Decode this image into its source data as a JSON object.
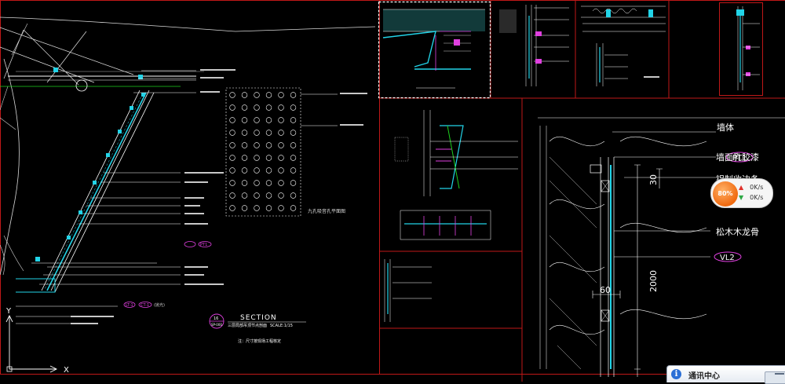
{
  "section_title": {
    "heading": "SECTION",
    "badge_top": "16",
    "badge_bottom": "SP-000",
    "name": "三层局部吊顶节点剖面",
    "scale": "SCALE:1/15",
    "note": "注：尺寸按现场工程核定"
  },
  "ucs": {
    "y_label": "Y",
    "x_label": "X"
  },
  "dims": {
    "d30": "30",
    "d2000": "2000",
    "d60": "60"
  },
  "detail_labels": {
    "wall": "墙体",
    "paint": "墙面乳胶漆",
    "paint_tag": "PT1",
    "trim": "铝制收边条",
    "wood": "松木木龙骨",
    "vl_tag": "VL2"
  },
  "panel_text": {
    "perforated_note": "九孔吸音孔平面图",
    "tag_pt1": "PT1",
    "tag_lt": "LT-1",
    "tag_ct": "CT-1",
    "tag_sub": "(抛光)"
  },
  "speed_widget": {
    "percent": "80%",
    "upload": "0K/s",
    "download": "0K/s"
  },
  "notification": {
    "title": "通讯中心",
    "icon_glyph": "i"
  }
}
